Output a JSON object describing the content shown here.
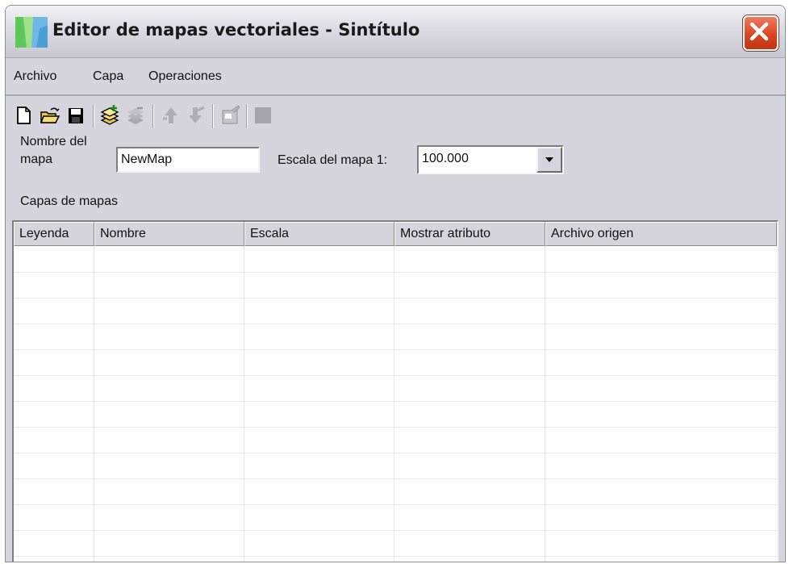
{
  "window": {
    "title": "Editor de mapas vectoriales - Sintítulo"
  },
  "menu": {
    "items": [
      "Archivo",
      "Capa",
      "Operaciones"
    ]
  },
  "toolbar": {
    "icons": [
      "new-file-icon",
      "open-folder-icon",
      "save-disk-icon",
      "add-layer-icon",
      "remove-layer-icon",
      "move-up-icon",
      "move-down-icon",
      "properties-icon",
      "color-swatch-icon"
    ]
  },
  "form": {
    "map_name_label_line1": "Nombre del",
    "map_name_label_line2": "mapa",
    "map_name_value": "NewMap",
    "scale_label": "Escala del mapa 1:",
    "scale_value": "100.000",
    "layers_label": "Capas de mapas"
  },
  "table": {
    "columns": [
      "Leyenda",
      "Nombre",
      "Escala",
      "Mostrar atributo",
      "Archivo origen"
    ],
    "rows": []
  },
  "colors": {
    "window_bg": "#d6d4dc",
    "close_button": "#d8421e"
  }
}
